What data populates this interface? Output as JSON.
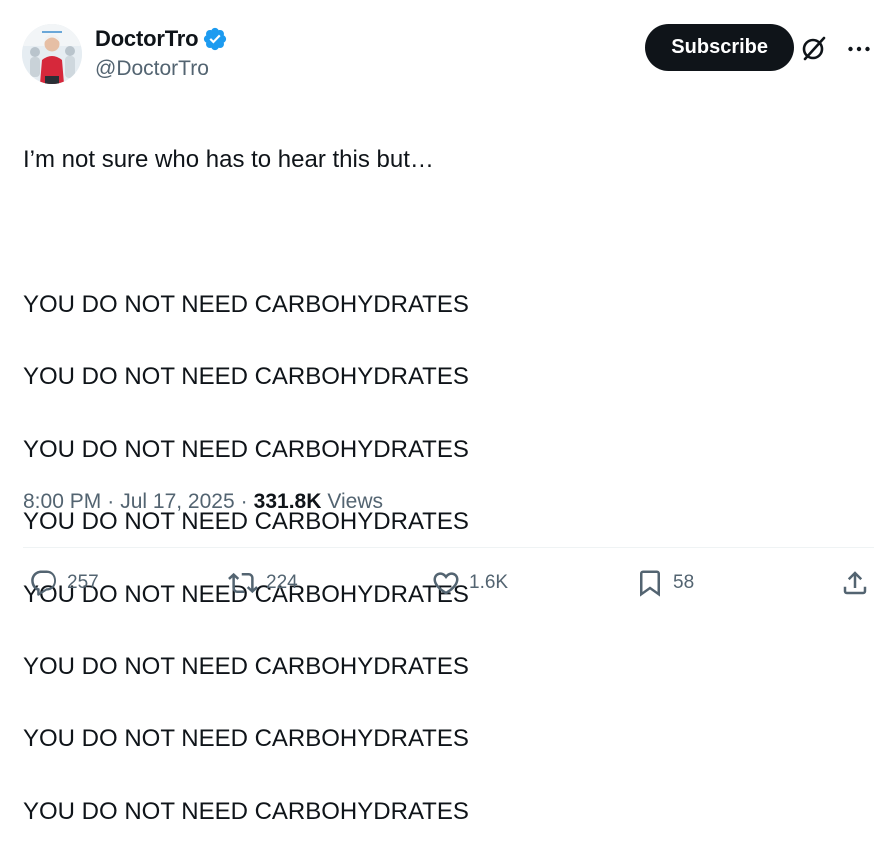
{
  "author": {
    "display_name": "DoctorTro",
    "handle": "@DoctorTro",
    "verified": true
  },
  "header": {
    "subscribe_label": "Subscribe",
    "grok_icon": "grok-icon",
    "more_icon": "more-icon"
  },
  "tweet": {
    "intro": "I’m not sure who has to hear this but…",
    "lines": [
      "YOU DO NOT NEED CARBOHYDRATES",
      "YOU DO NOT NEED CARBOHYDRATES",
      "YOU DO NOT NEED CARBOHYDRATES",
      "YOU DO NOT NEED CARBOHYDRATES",
      "YOU DO NOT NEED CARBOHYDRATES",
      "YOU DO NOT NEED CARBOHYDRATES",
      "YOU DO NOT NEED CARBOHYDRATES",
      "YOU DO NOT NEED CARBOHYDRATES"
    ]
  },
  "meta": {
    "time": "8:00 PM",
    "separator": "·",
    "date": "Jul 17, 2025",
    "views_count": "331.8K",
    "views_label": "Views"
  },
  "actions": {
    "replies": "257",
    "reposts": "224",
    "likes": "1.6K",
    "bookmarks": "58"
  },
  "colors": {
    "text_primary": "#0f1419",
    "text_secondary": "#536471",
    "verified_blue": "#1d9bf0",
    "button_dark": "#0f1419",
    "divider": "#eff3f4"
  }
}
